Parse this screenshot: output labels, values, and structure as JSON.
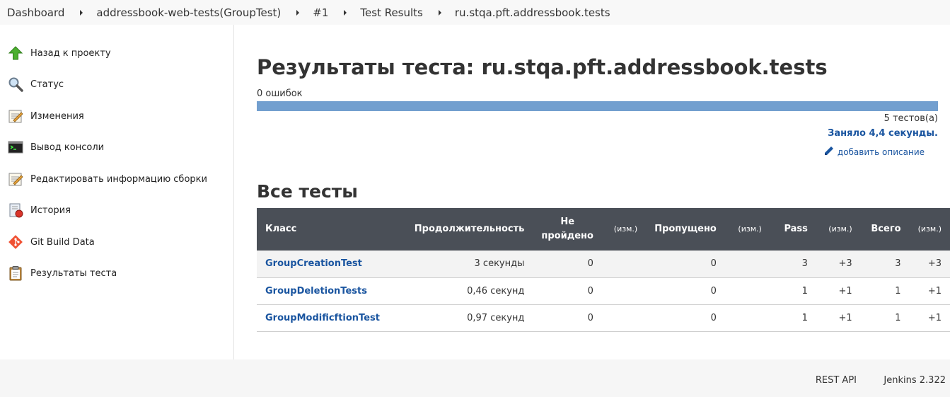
{
  "breadcrumb": [
    "Dashboard",
    "addressbook-web-tests(GroupTest)",
    "#1",
    "Test Results",
    "ru.stqa.pft.addressbook.tests"
  ],
  "sidebar": {
    "items": [
      {
        "label": "Назад к проекту",
        "icon": "up-arrow-icon"
      },
      {
        "label": "Статус",
        "icon": "magnifier-icon"
      },
      {
        "label": "Изменения",
        "icon": "notepad-icon"
      },
      {
        "label": "Вывод консоли",
        "icon": "terminal-icon"
      },
      {
        "label": "Редактировать информацию сборки",
        "icon": "notepad-edit-icon"
      },
      {
        "label": "История",
        "icon": "history-icon"
      },
      {
        "label": "Git Build Data",
        "icon": "git-icon"
      },
      {
        "label": "Результаты теста",
        "icon": "clipboard-icon"
      }
    ]
  },
  "main": {
    "title": "Результаты теста: ru.stqa.pft.addressbook.tests",
    "failures": "0 ошибок",
    "tests_count": "5 тестов(а)",
    "duration": "Заняло 4,4 секунды.",
    "add_description": "добавить описание",
    "section_title": "Все тесты",
    "table": {
      "headers": {
        "class": "Класс",
        "duration": "Продолжительность",
        "failed_line1": "Не",
        "failed_line2": "пройдено",
        "diff1": "(изм.)",
        "skipped": "Пропущено",
        "diff2": "(изм.)",
        "pass": "Pass",
        "diff3": "(изм.)",
        "total": "Всего",
        "diff4": "(изм.)"
      },
      "rows": [
        {
          "class": "GroupCreationTest",
          "duration": "3 секунды",
          "failed": "0",
          "skipped": "0",
          "pass": "3",
          "pass_diff": "+3",
          "total": "3",
          "total_diff": "+3"
        },
        {
          "class": "GroupDeletionTests",
          "duration": "0,46 секунд",
          "failed": "0",
          "skipped": "0",
          "pass": "1",
          "pass_diff": "+1",
          "total": "1",
          "total_diff": "+1"
        },
        {
          "class": "GroupModificftionTest",
          "duration": "0,97 секунд",
          "failed": "0",
          "skipped": "0",
          "pass": "1",
          "pass_diff": "+1",
          "total": "1",
          "total_diff": "+1"
        }
      ]
    }
  },
  "footer": {
    "rest_api": "REST API",
    "version": "Jenkins 2.322"
  },
  "colors": {
    "link": "#1a55a0",
    "progress": "#729fcf",
    "table_header": "#4a4f57"
  }
}
